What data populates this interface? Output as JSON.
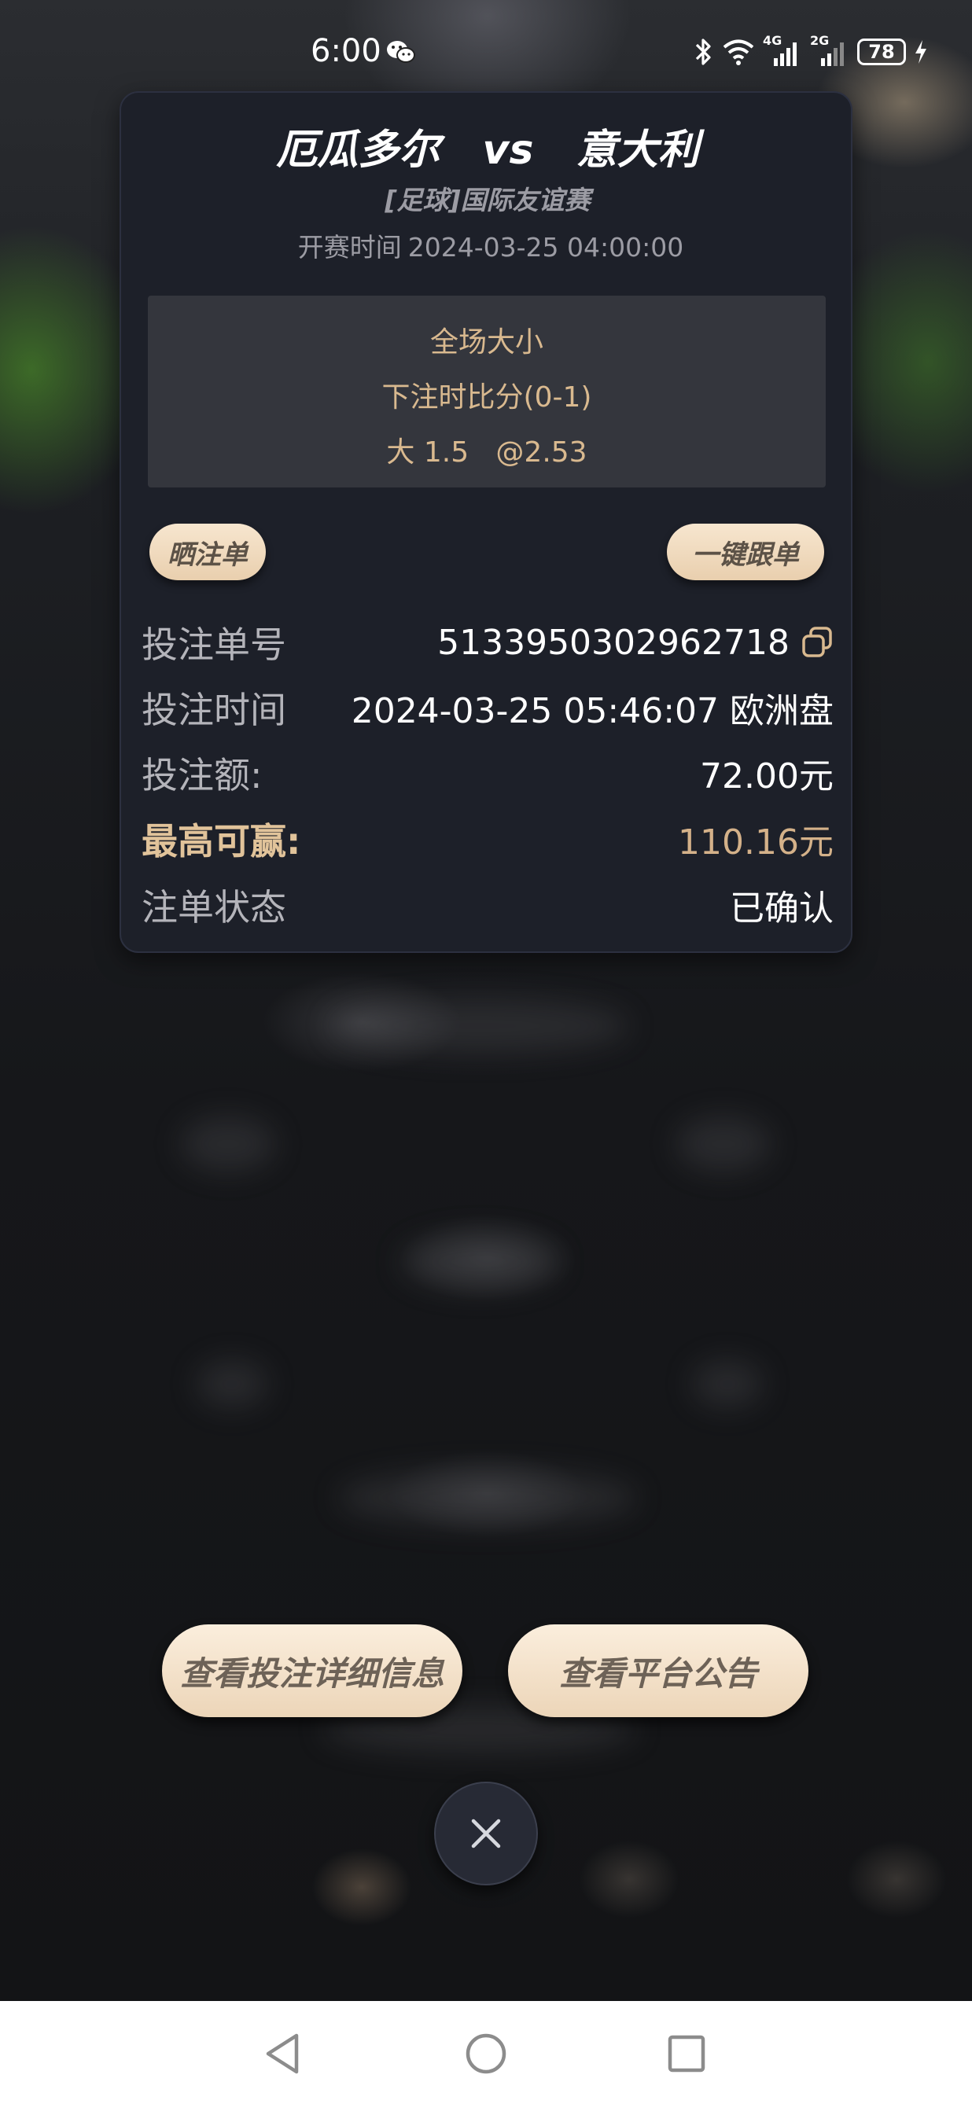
{
  "status_bar": {
    "time": "6:00",
    "network_4g": "4G",
    "network_2g": "2G",
    "battery": "78"
  },
  "match": {
    "title": "厄瓜多尔   vs   意大利",
    "league": "[足球]国际友谊赛",
    "kickoff_label": "开赛时间",
    "kickoff_time": "2024-03-25 04:00:00"
  },
  "bet": {
    "market": "全场大小",
    "score_at_bet": "下注时比分(0-1)",
    "selection": "大 1.5   @2.53"
  },
  "actions": {
    "share_label": "晒注单",
    "follow_label": "一键跟单"
  },
  "details": {
    "order_no_label": "投注单号",
    "order_no": "5133950302962718",
    "bet_time_label": "投注时间",
    "bet_time": "2024-03-25 05:46:07 欧洲盘",
    "amount_label": "投注额:",
    "amount": "72.00元",
    "max_win_label": "最高可赢:",
    "max_win": "110.16元",
    "status_label": "注单状态",
    "status": "已确认"
  },
  "bottom_buttons": {
    "detail_label": "查看投注详细信息",
    "notice_label": "查看平台公告"
  },
  "colors": {
    "accent_gold": "#d9b98f",
    "card_bg": "#1d2029",
    "pill_bg": "#f3e0c6"
  }
}
